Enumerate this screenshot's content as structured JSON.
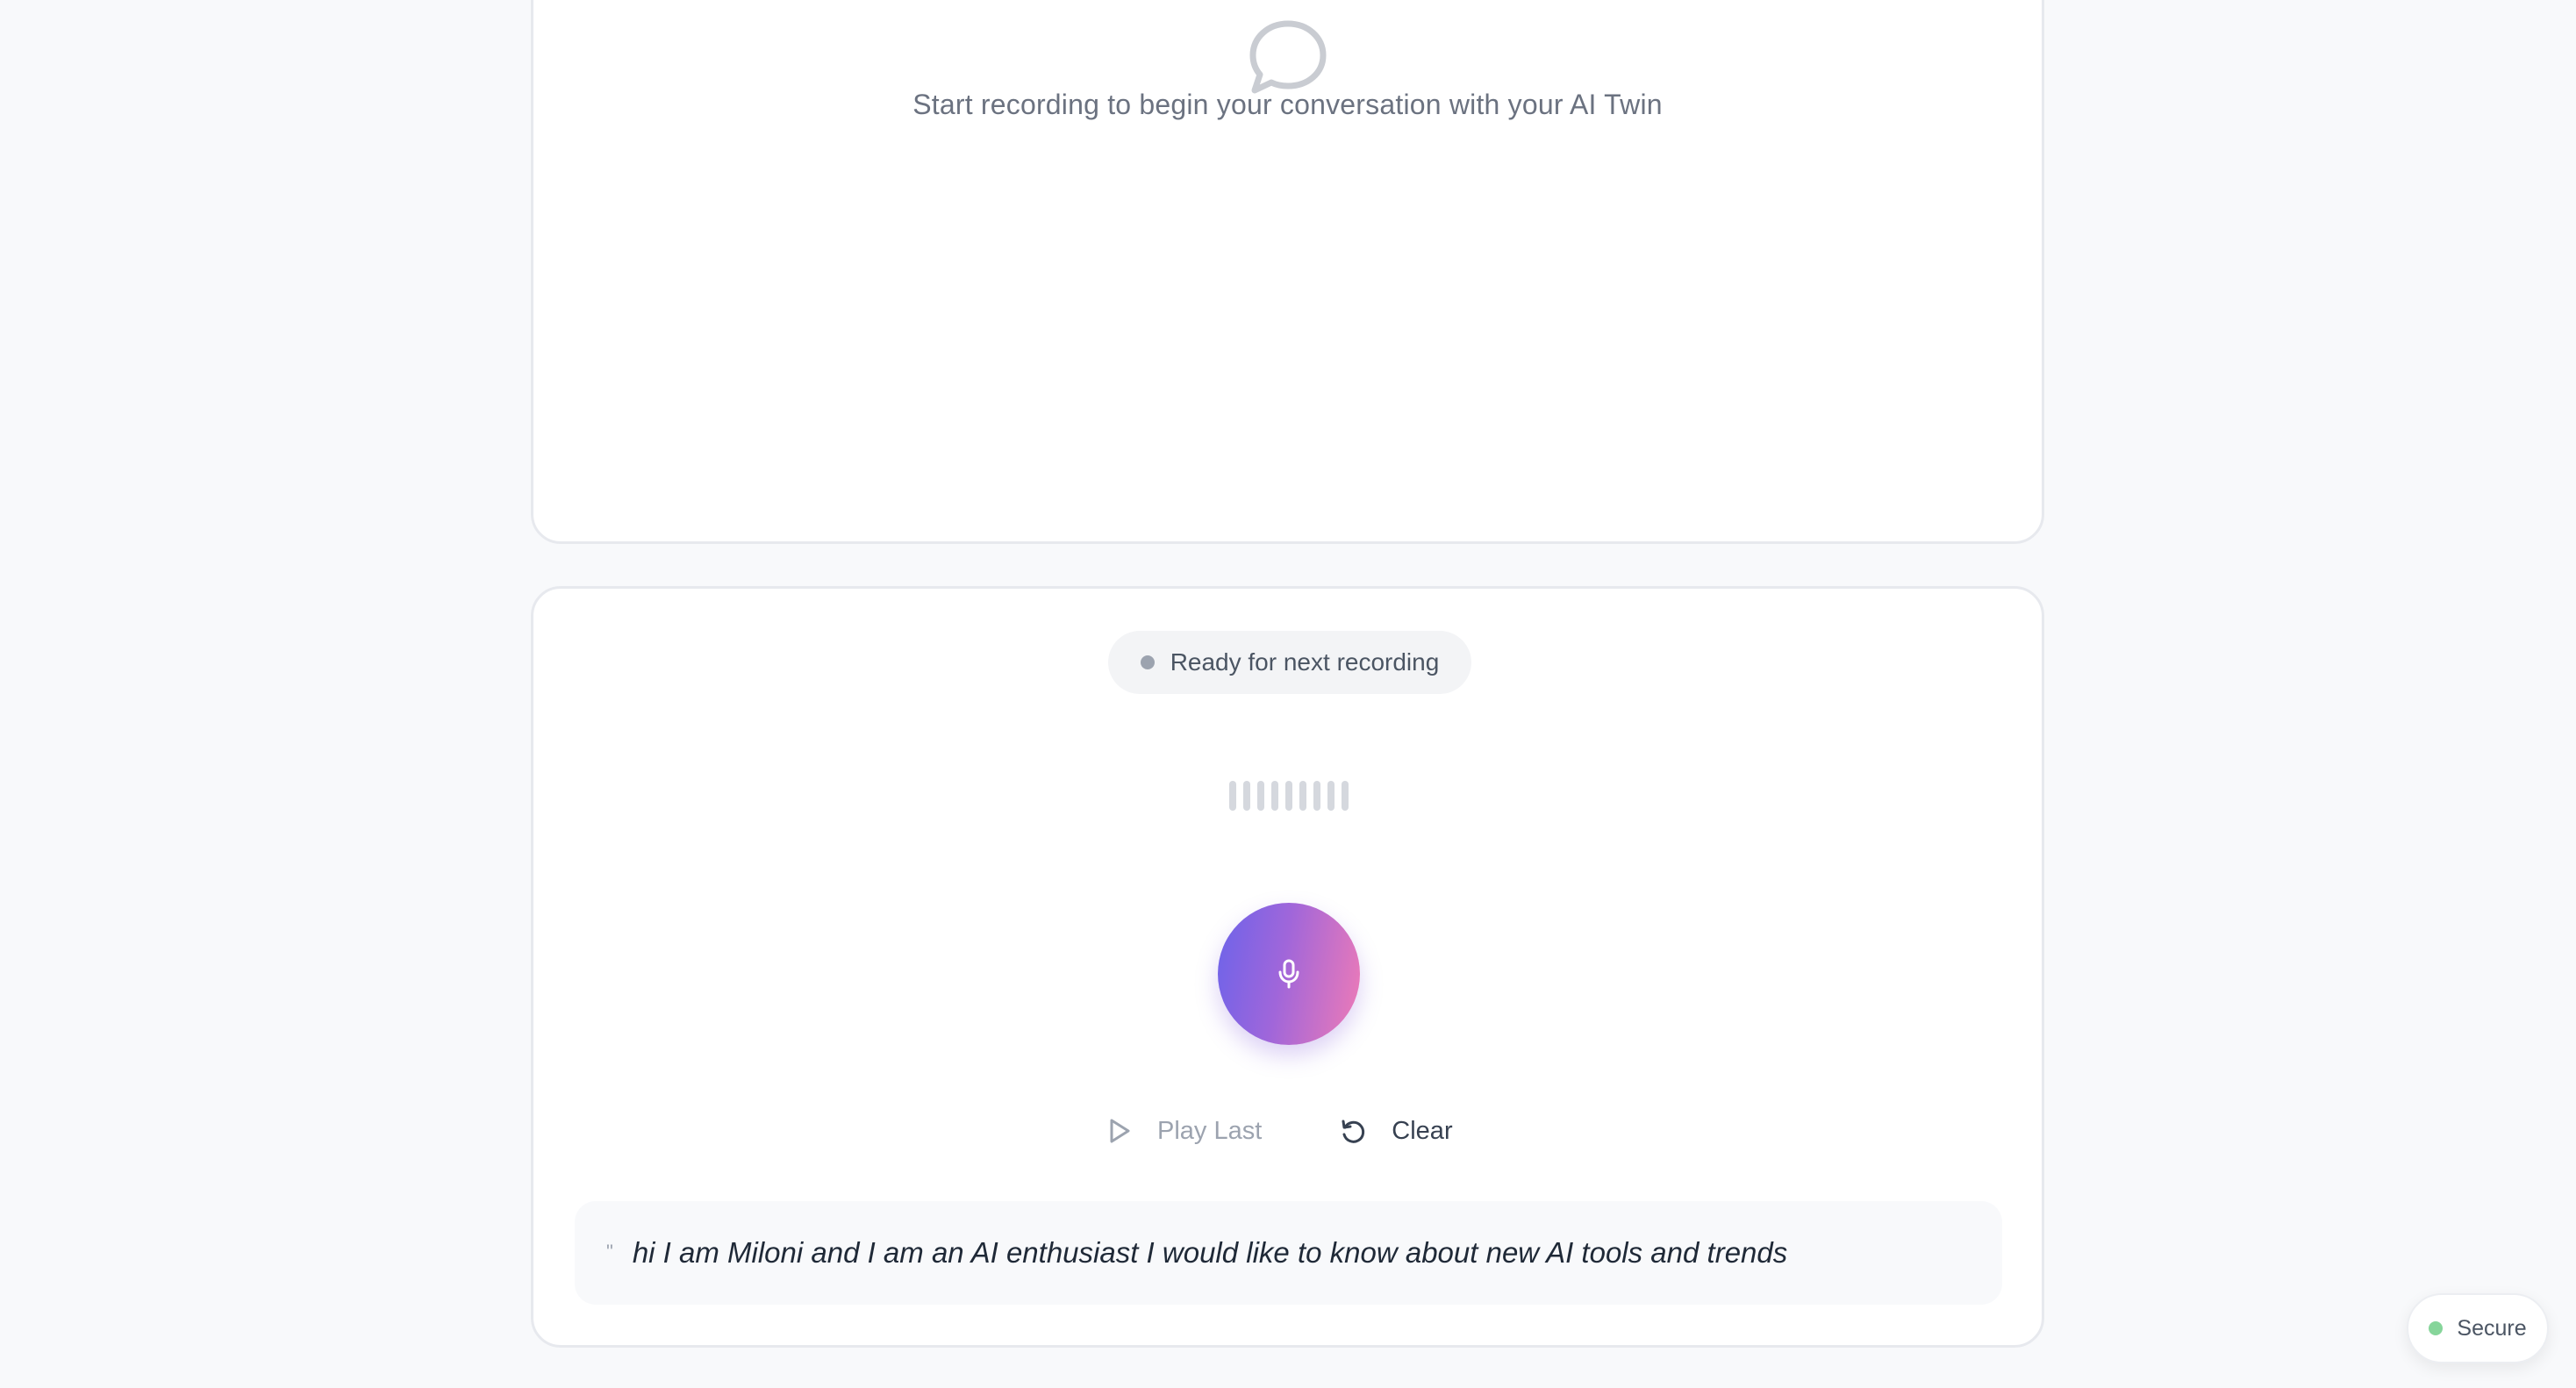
{
  "conversation": {
    "icon": "chat-bubble-icon",
    "empty_message": "Start recording to begin your conversation with your AI Twin"
  },
  "recorder": {
    "status": "Ready for next recording",
    "status_dot_color": "#9ca3af",
    "waveform_bars": 9,
    "mic_icon": "microphone-icon",
    "mic_gradient": [
      "#6c63ea",
      "#ef7bb6"
    ],
    "play_last_label": "Play Last",
    "play_icon": "play-icon",
    "clear_label": "Clear",
    "clear_icon": "refresh-icon"
  },
  "transcript": {
    "quote_mark": "\"",
    "text": "hi I am Miloni and I am an AI enthusiast I would like to know about new AI tools and trends"
  },
  "secure_badge": {
    "label": "Secure",
    "dot_color": "#86d59a"
  }
}
